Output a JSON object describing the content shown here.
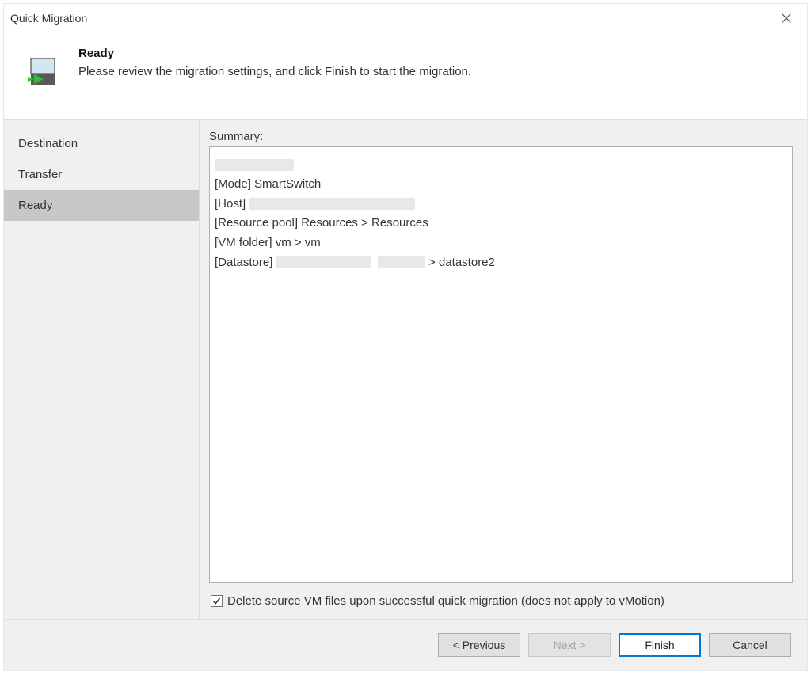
{
  "titlebar": {
    "title": "Quick Migration"
  },
  "header": {
    "title": "Ready",
    "subtitle": "Please review the migration settings, and click Finish to start the migration."
  },
  "sidebar": {
    "items": [
      {
        "label": "Destination",
        "selected": false
      },
      {
        "label": "Transfer",
        "selected": false
      },
      {
        "label": "Ready",
        "selected": true
      }
    ]
  },
  "main": {
    "summary_label": "Summary:",
    "summary": {
      "mode_line_prefix": "[Mode] ",
      "mode_value": "SmartSwitch",
      "host_line_prefix": "[Host] ",
      "resource_pool_line": "[Resource pool] Resources > Resources",
      "vm_folder_line": "[VM folder] vm > vm",
      "datastore_prefix": "[Datastore] ",
      "datastore_suffix": " > datastore2"
    },
    "checkbox_label": "Delete source VM files upon successful quick migration (does not apply to vMotion)",
    "checkbox_checked": true
  },
  "footer": {
    "previous": "< Previous",
    "next": "Next >",
    "finish": "Finish",
    "cancel": "Cancel"
  }
}
